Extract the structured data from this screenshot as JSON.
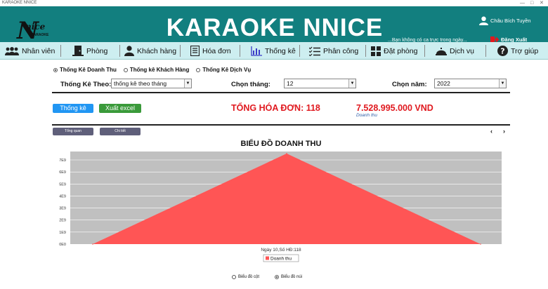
{
  "window": {
    "title": "KARAOKE NNICE"
  },
  "header": {
    "logo_text": "nice",
    "logo_sub": "KARAOKE",
    "title": "KARAOKE NNICE",
    "slogan": "...Bạn không có ca trực trong ngày...",
    "user_name": "Châu Bích Tuyền",
    "logout_label": "Đăng Xuất"
  },
  "nav": [
    {
      "label": "Nhân viên",
      "icon": "users-icon"
    },
    {
      "label": "Phòng",
      "icon": "door-icon"
    },
    {
      "label": "Khách hàng",
      "icon": "person-icon"
    },
    {
      "label": "Hóa đơn",
      "icon": "receipt-icon"
    },
    {
      "label": "Thống kê",
      "icon": "bar-chart-icon"
    },
    {
      "label": "Phân công",
      "icon": "task-list-icon"
    },
    {
      "label": "Đặt phòng",
      "icon": "grid-icon"
    },
    {
      "label": "Dịch vụ",
      "icon": "service-bell-icon"
    },
    {
      "label": "Trợ giúp",
      "icon": "help-icon"
    }
  ],
  "report_types": [
    {
      "label": "Thống Kê Doanh Thu",
      "selected": true
    },
    {
      "label": "Thống kê Khách Hàng",
      "selected": false
    },
    {
      "label": "Thống Kê Dịch Vụ",
      "selected": false
    }
  ],
  "filters": {
    "by_label": "Thống Kê Theo:",
    "by_value": "thống kê theo tháng",
    "month_label": "Chọn tháng:",
    "month_value": "12",
    "year_label": "Chọn năm:",
    "year_value": "2022"
  },
  "actions": {
    "stats_button": "Thống kê",
    "export_button": "Xuất excel"
  },
  "summary": {
    "total_invoices": "TỔNG HÓA ĐƠN: 118",
    "revenue": "7.528.995.000 VND",
    "revenue_sub": "Doanh thu"
  },
  "view_tabs": {
    "overview": "Tổng quan",
    "detail": "Chi tiết"
  },
  "chart_options": {
    "bar": "Biểu đồ cột",
    "area": "Biểu đồ núi",
    "selected": "area"
  },
  "colors": {
    "header": "#127f7f",
    "nav": "#cdeef0",
    "series": "#ff5555",
    "plot_bg": "#c0c0c0"
  },
  "chart_data": {
    "type": "area",
    "title": "BIỂU ĐỒ DOANH THU",
    "xlabel": "Ngày 10,Số HĐ:118",
    "ylabel": "",
    "y_ticks": [
      "0E0",
      "1E9",
      "2E9",
      "3E9",
      "4E9",
      "5E9",
      "6E9",
      "7E9"
    ],
    "ylim": [
      0,
      7700000000.0
    ],
    "x": [
      0,
      1,
      2
    ],
    "series": [
      {
        "name": "Doanh thu",
        "values": [
          0,
          7529000000.0,
          0
        ]
      }
    ],
    "grid": true,
    "legend_position": "bottom"
  }
}
